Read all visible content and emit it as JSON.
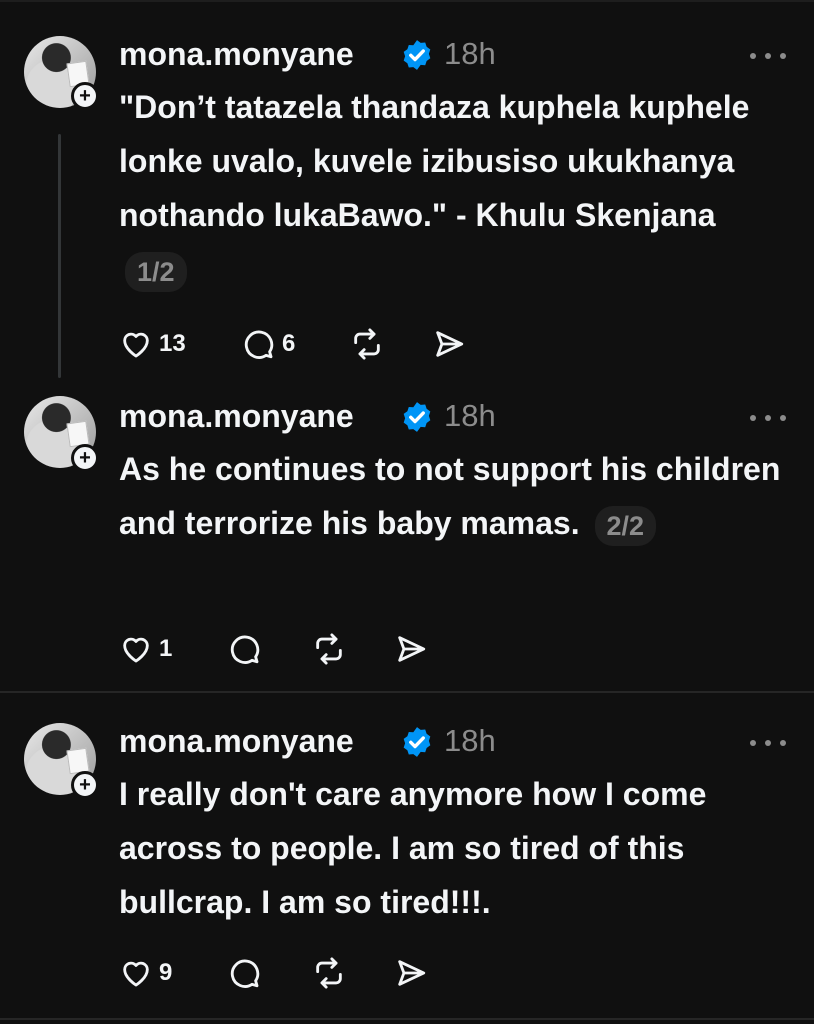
{
  "posts": [
    {
      "username": "mona.monyane",
      "time": "18h",
      "text": "\"Don’t tatazela thandaza kuphela kuphele lonke uvalo, kuvele izibusiso ukukhanya nothando lukaBawo.\" - Khulu Skenjana",
      "pager": "1/2",
      "likes": "13",
      "replies": "6"
    },
    {
      "username": "mona.monyane",
      "time": "18h",
      "text": "As he continues to not support his children and terrorize his baby mamas.",
      "pager": "2/2",
      "likes": "1",
      "replies": ""
    },
    {
      "username": "mona.monyane",
      "time": "18h",
      "text": "I really don't care anymore how I come across to people. I am so tired of this bullcrap. I am so tired!!!.",
      "likes": "9",
      "replies": ""
    }
  ],
  "icons": {
    "follow": "plus-icon",
    "verified": "verified-badge-icon",
    "more": "more-options-icon",
    "like": "heart-icon",
    "reply": "comment-icon",
    "repost": "repost-icon",
    "share": "share-icon"
  },
  "colors": {
    "background": "#101010",
    "verified": "#0095f6",
    "muted": "#8c8c8c"
  }
}
